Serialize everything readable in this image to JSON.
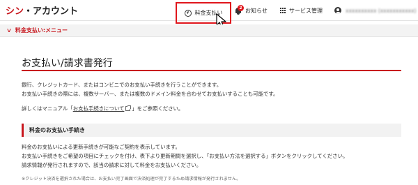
{
  "header": {
    "logo_part1": "シン",
    "logo_part2": "・アカウント",
    "nav": {
      "payment_label": "料金支払い",
      "news_label": "お知らせ",
      "news_badge": "2",
      "service_label": "サービス管理",
      "user_label": "xxxxxxxxxx (xxxxxxxxxxx)"
    },
    "payment_icon_glyph": "¥"
  },
  "breadcrumb": {
    "label": "料金支払い:メニュー"
  },
  "main": {
    "title": "お支払い/請求書発行",
    "intro_line1": "銀行、クレジットカード、またはコンビニでのお支払い手続きを行うことができます。",
    "intro_line2": "お支払い手続きの際には、複数サーバー、または複数のドメイン料金を合わせてお支払いすることも可能です。",
    "manual_prefix": "詳しくはマニュアル「",
    "manual_link": "お支払手続きについて",
    "manual_suffix": "」をご参照ください。",
    "section_title": "料金のお支払い手続き",
    "section_line1": "料金のお支払いによる更新手続きが可能なご契約を表示しています。",
    "section_line2": "お支払い手続きをご希望の項目にチェックを付け、表下より更新期間を選択し、「お支払い方法を選択する」ボタンをクリックしてください。",
    "section_line3": "請求情報が発行されますので、該当の請求に対して料金をお支払いください。",
    "footnote": "※クレジット決済を選択された場合は、お支払い完了画面で決済処理が完了するため請求情報が発行されません。"
  },
  "colors": {
    "accent": "#c8161d",
    "highlight_box": "#e0161c"
  },
  "icons": [
    "yen-icon",
    "bell-icon",
    "grid-icon",
    "user-icon",
    "chevron-down-icon",
    "external-link-icon",
    "mouse-cursor-icon"
  ]
}
